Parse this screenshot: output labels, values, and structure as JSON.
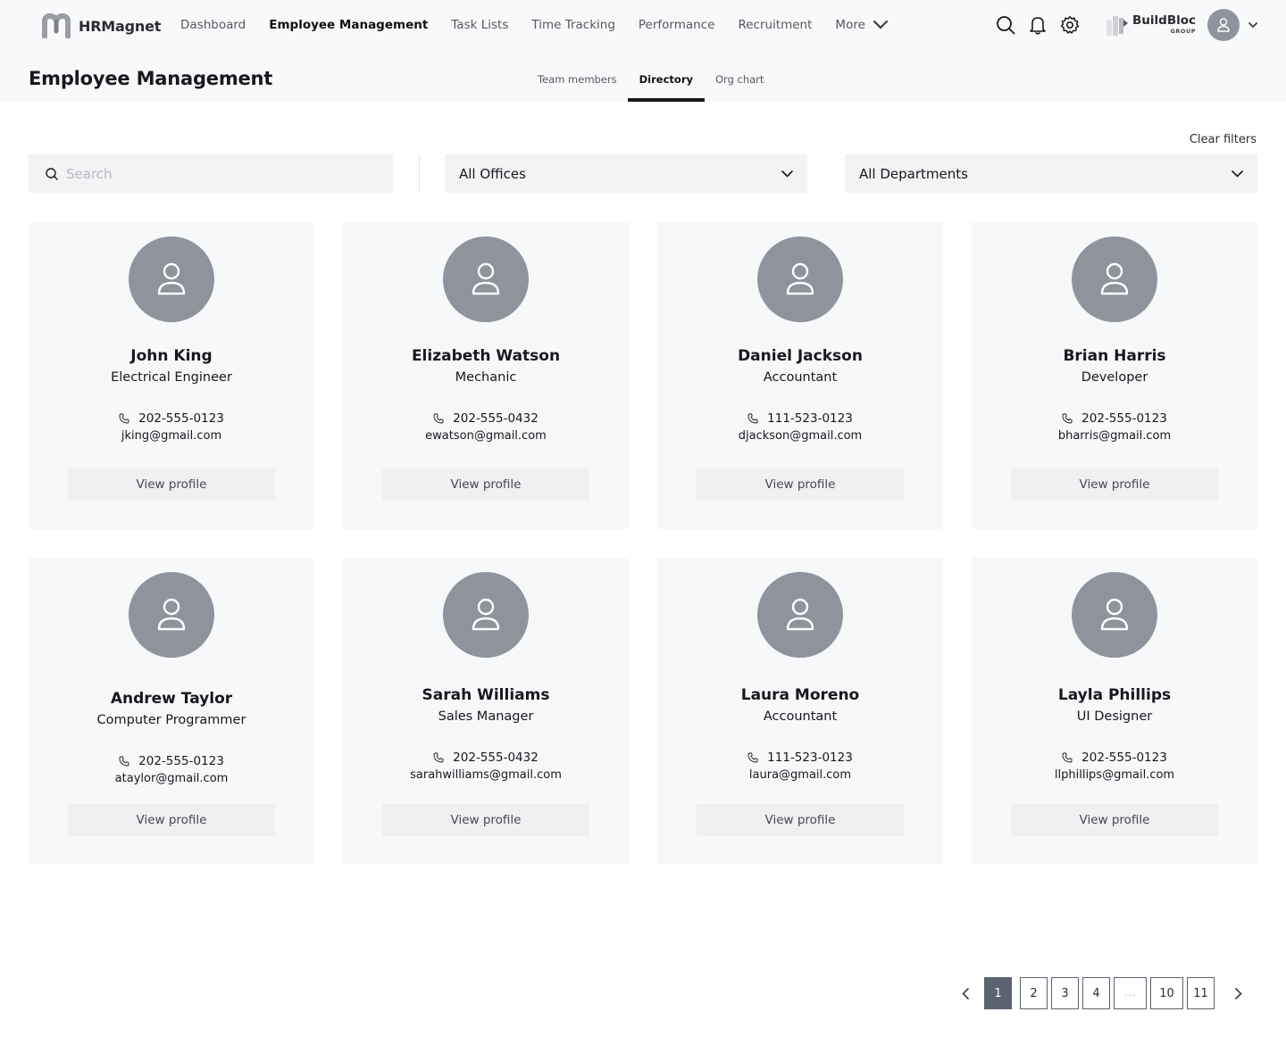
{
  "app": {
    "name": "HRMagnet",
    "logo_icon": "m-logo-icon"
  },
  "nav": {
    "items": [
      {
        "label": "Dashboard",
        "active": false
      },
      {
        "label": "Employee Management",
        "active": true
      },
      {
        "label": "Task Lists",
        "active": false
      },
      {
        "label": "Time Tracking",
        "active": false
      },
      {
        "label": "Performance",
        "active": false
      },
      {
        "label": "Recruitment",
        "active": false
      }
    ],
    "more_label": "More"
  },
  "header_icons": [
    "search-icon",
    "bell-icon",
    "gear-icon"
  ],
  "company": {
    "name": "BuildBloc",
    "sub": "GROUP"
  },
  "user": {
    "avatar_icon": "user-icon"
  },
  "page": {
    "title": "Employee Management",
    "tabs": [
      {
        "label": "Team members",
        "active": false
      },
      {
        "label": "Directory",
        "active": true
      },
      {
        "label": "Org chart",
        "active": false
      }
    ]
  },
  "filters": {
    "clear_label": "Clear filters",
    "search_placeholder": "Search",
    "search_value": "",
    "offices": "All Offices",
    "departments": "All Departments"
  },
  "employees": [
    {
      "name": "John King",
      "title": "Electrical Engineer",
      "phone": "202-555-0123",
      "email": "jking@gmail.com",
      "button": "View profile"
    },
    {
      "name": "Elizabeth Watson",
      "title": "Mechanic",
      "phone": "202-555-0432",
      "email": "ewatson@gmail.com",
      "button": "View profile"
    },
    {
      "name": "Daniel Jackson",
      "title": "Accountant",
      "phone": "111-523-0123",
      "email": "djackson@gmail.com",
      "button": "View profile"
    },
    {
      "name": "Brian Harris",
      "title": "Developer",
      "phone": "202-555-0123",
      "email": "bharris@gmail.com",
      "button": "View profile"
    },
    {
      "name": "Andrew Taylor",
      "title": "Computer Programmer",
      "phone": "202-555-0123",
      "email": "ataylor@gmail.com",
      "button": "View profile"
    },
    {
      "name": "Sarah Williams",
      "title": "Sales Manager",
      "phone": "202-555-0432",
      "email": "sarahwilliams@gmail.com",
      "button": "View profile"
    },
    {
      "name": "Laura Moreno",
      "title": "Accountant",
      "phone": "111-523-0123",
      "email": "laura@gmail.com",
      "button": "View profile"
    },
    {
      "name": "Layla Phillips",
      "title": "UI Designer",
      "phone": "202-555-0123",
      "email": "llphillips@gmail.com",
      "button": "View profile"
    }
  ],
  "pagination": {
    "current": "1",
    "pages": [
      "1",
      "2",
      "3",
      "4",
      "...",
      "10",
      "11"
    ],
    "colors": {
      "active_bg": "#5b6270",
      "active_text": "#ffffff"
    }
  }
}
